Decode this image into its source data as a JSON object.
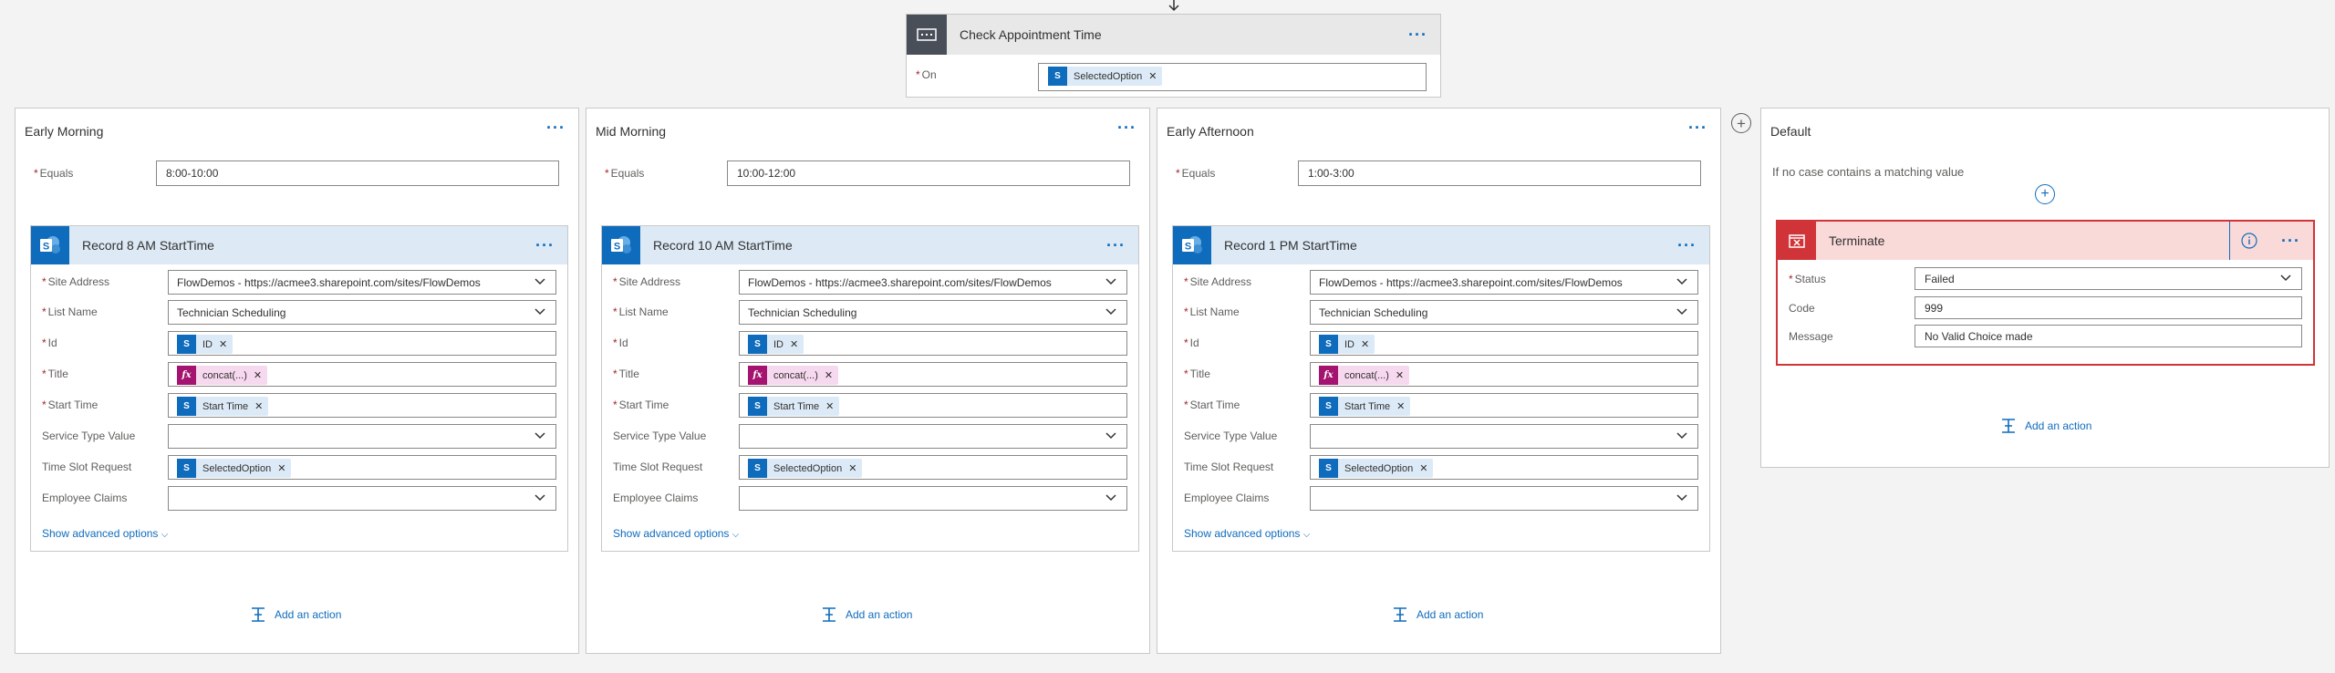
{
  "switch": {
    "title": "Check Appointment Time",
    "on_label": "On",
    "on_token": "SelectedOption"
  },
  "cases": [
    {
      "title": "Early Morning",
      "equals_label": "Equals",
      "equals_value": "8:00-10:00",
      "action_title": "Record 8 AM StartTime",
      "fields": {
        "site_label": "Site Address",
        "site_value": "FlowDemos - https://acmee3.sharepoint.com/sites/FlowDemos",
        "list_label": "List Name",
        "list_value": "Technician Scheduling",
        "id_label": "Id",
        "id_token": "ID",
        "title_label": "Title",
        "title_token": "concat(...)",
        "start_label": "Start Time",
        "start_token": "Start Time",
        "service_label": "Service Type Value",
        "timeslot_label": "Time Slot Request",
        "timeslot_token": "SelectedOption",
        "claims_label": "Employee Claims"
      },
      "show_advanced": "Show advanced options",
      "add_action": "Add an action"
    },
    {
      "title": "Mid Morning",
      "equals_label": "Equals",
      "equals_value": "10:00-12:00",
      "action_title": "Record 10 AM StartTime",
      "fields": {
        "site_label": "Site Address",
        "site_value": "FlowDemos - https://acmee3.sharepoint.com/sites/FlowDemos",
        "list_label": "List Name",
        "list_value": "Technician Scheduling",
        "id_label": "Id",
        "id_token": "ID",
        "title_label": "Title",
        "title_token": "concat(...)",
        "start_label": "Start Time",
        "start_token": "Start Time",
        "service_label": "Service Type Value",
        "timeslot_label": "Time Slot Request",
        "timeslot_token": "SelectedOption",
        "claims_label": "Employee Claims"
      },
      "show_advanced": "Show advanced options",
      "add_action": "Add an action"
    },
    {
      "title": "Early Afternoon",
      "equals_label": "Equals",
      "equals_value": "1:00-3:00",
      "action_title": "Record 1 PM StartTime",
      "fields": {
        "site_label": "Site Address",
        "site_value": "FlowDemos - https://acmee3.sharepoint.com/sites/FlowDemos",
        "list_label": "List Name",
        "list_value": "Technician Scheduling",
        "id_label": "Id",
        "id_token": "ID",
        "title_label": "Title",
        "title_token": "concat(...)",
        "start_label": "Start Time",
        "start_token": "Start Time",
        "service_label": "Service Type Value",
        "timeslot_label": "Time Slot Request",
        "timeslot_token": "SelectedOption",
        "claims_label": "Employee Claims"
      },
      "show_advanced": "Show advanced options",
      "add_action": "Add an action"
    }
  ],
  "default_case": {
    "title": "Default",
    "description": "If no case contains a matching value",
    "terminate": {
      "title": "Terminate",
      "status_label": "Status",
      "status_value": "Failed",
      "code_label": "Code",
      "code_value": "999",
      "message_label": "Message",
      "message_value": "No Valid Choice made"
    },
    "add_action": "Add an action"
  },
  "colors": {
    "accent": "#0f6cbd",
    "terminate_red": "#d13438",
    "expression_pink": "#a4136f"
  }
}
